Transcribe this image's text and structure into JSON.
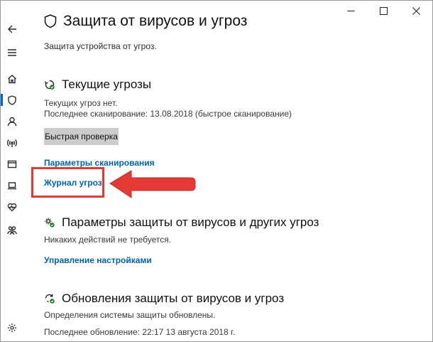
{
  "header": {
    "title": "Защита от вирусов и угроз",
    "subtitle": "Защита устройства от угроз."
  },
  "nav": {
    "items": [
      {
        "icon": "back-arrow-icon"
      },
      {
        "icon": "hamburger-menu-icon"
      },
      {
        "icon": "home-icon"
      },
      {
        "icon": "shield-icon",
        "active": true
      },
      {
        "icon": "account-icon"
      },
      {
        "icon": "network-icon"
      },
      {
        "icon": "app-browser-icon"
      },
      {
        "icon": "device-security-icon"
      },
      {
        "icon": "health-heart-icon"
      },
      {
        "icon": "family-icon"
      },
      {
        "icon": "settings-gear-icon"
      }
    ]
  },
  "caption": {
    "minimize": "minimize-icon",
    "maximize": "maximize-icon",
    "close": "close-icon"
  },
  "threats": {
    "title": "Текущие угрозы",
    "status": "Текущих угроз нет.",
    "last_scan": "Последнее сканирование: 13.08.2018 (быстрое сканирование)",
    "quick_scan_label": "Быстрая проверка",
    "scan_options_link": "Параметры сканирования",
    "history_link": "Журнал угроз"
  },
  "protection_settings": {
    "title": "Параметры защиты от вирусов и других угроз",
    "status": "Никаких действий не требуется.",
    "manage_link": "Управление настройками"
  },
  "updates": {
    "title": "Обновления защиты от вирусов и угроз",
    "status": "Определения системы защиты обновлены.",
    "last_update": "Последнее обновление: 22:17 13 августа 2018 г."
  },
  "colors": {
    "accent": "#0063b1",
    "highlight": "#e53935",
    "button": "#cccccc",
    "ok_green": "#107c10"
  }
}
